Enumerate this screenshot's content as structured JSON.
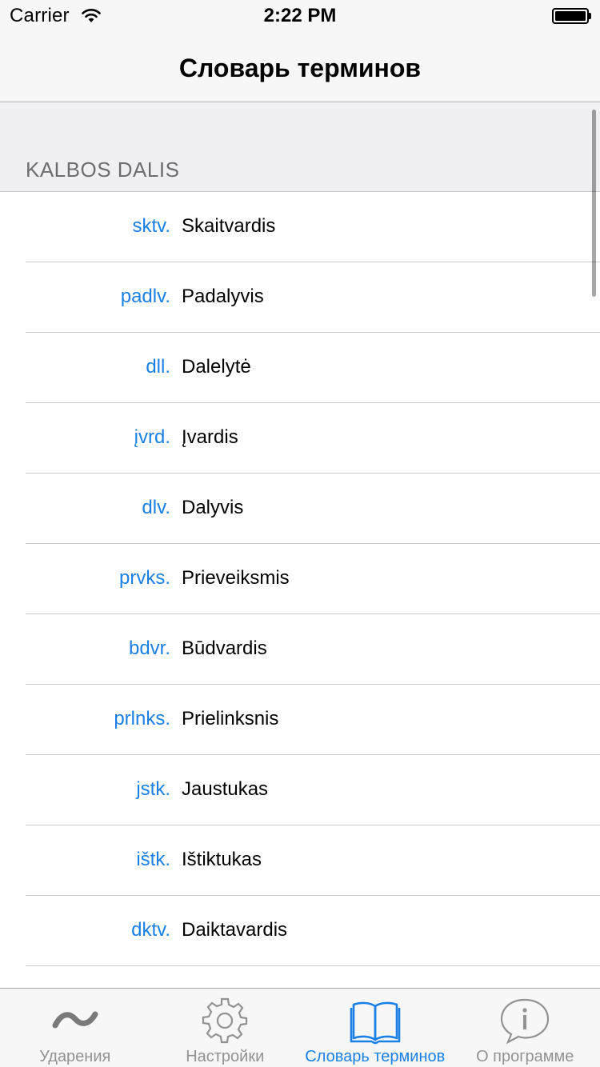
{
  "status_bar": {
    "carrier": "Carrier",
    "time": "2:22 PM"
  },
  "nav": {
    "title": "Словарь терминов"
  },
  "section": {
    "header": "KALBOS DALIS"
  },
  "rows": [
    {
      "abbr": "sktv.",
      "term": "Skaitvardis"
    },
    {
      "abbr": "padlv.",
      "term": "Padalyvis"
    },
    {
      "abbr": "dll.",
      "term": "Dalelytė"
    },
    {
      "abbr": "įvrd.",
      "term": "Įvardis"
    },
    {
      "abbr": "dlv.",
      "term": "Dalyvis"
    },
    {
      "abbr": "prvks.",
      "term": "Prieveiksmis"
    },
    {
      "abbr": "bdvr.",
      "term": "Būdvardis"
    },
    {
      "abbr": "prlnks.",
      "term": "Prielinksnis"
    },
    {
      "abbr": "jstk.",
      "term": "Jaustukas"
    },
    {
      "abbr": "ištk.",
      "term": "Ištiktukas"
    },
    {
      "abbr": "dktv.",
      "term": "Daiktavardis"
    }
  ],
  "tabs": [
    {
      "label": "Ударения",
      "icon": "tilde-icon",
      "active": false
    },
    {
      "label": "Настройки",
      "icon": "gear-icon",
      "active": false
    },
    {
      "label": "Словарь терминов",
      "icon": "book-icon",
      "active": true
    },
    {
      "label": "О программе",
      "icon": "info-bubble-icon",
      "active": false
    }
  ],
  "colors": {
    "accent": "#1a80e5",
    "inactive": "#929292",
    "bar_bg": "#f7f7f7",
    "section_bg": "#efeff4"
  }
}
